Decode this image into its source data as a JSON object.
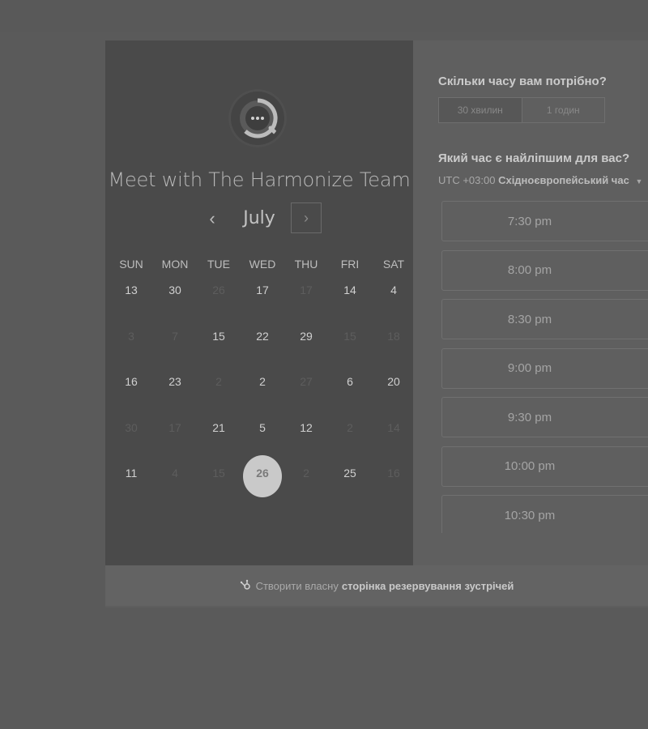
{
  "header": {
    "title": "Meet with The Harmonize Team",
    "avatar_icon": "chat-dots-icon"
  },
  "calendar": {
    "month": "July",
    "prev_icon": "chevron-left-icon",
    "next_icon": "chevron-right-icon",
    "prev_glyph": "‹",
    "next_glyph": "›",
    "weekdays": [
      "SUN",
      "MON",
      "TUE",
      "WED",
      "THU",
      "FRI",
      "SAT"
    ],
    "weeks": [
      [
        {
          "d": "13",
          "off": false
        },
        {
          "d": "30",
          "off": false
        },
        {
          "d": "26",
          "off": true
        },
        {
          "d": "17",
          "off": false
        },
        {
          "d": "17",
          "off": true
        },
        {
          "d": "14",
          "off": false
        },
        {
          "d": "4",
          "off": false
        }
      ],
      [
        {
          "d": "3",
          "off": true
        },
        {
          "d": "7",
          "off": true
        },
        {
          "d": "15",
          "off": false
        },
        {
          "d": "22",
          "off": false
        },
        {
          "d": "29",
          "off": false
        },
        {
          "d": "15",
          "off": true
        },
        {
          "d": "18",
          "off": true
        }
      ],
      [
        {
          "d": "16",
          "off": false
        },
        {
          "d": "23",
          "off": false
        },
        {
          "d": "2",
          "off": true
        },
        {
          "d": "2",
          "off": false
        },
        {
          "d": "27",
          "off": true
        },
        {
          "d": "6",
          "off": false
        },
        {
          "d": "20",
          "off": false
        }
      ],
      [
        {
          "d": "30",
          "off": true
        },
        {
          "d": "17",
          "off": true
        },
        {
          "d": "21",
          "off": false
        },
        {
          "d": "5",
          "off": false
        },
        {
          "d": "12",
          "off": false
        },
        {
          "d": "2",
          "off": true
        },
        {
          "d": "14",
          "off": true
        }
      ],
      [
        {
          "d": "11",
          "off": false
        },
        {
          "d": "4",
          "off": true
        },
        {
          "d": "15",
          "off": true
        },
        {
          "d": "26",
          "off": false,
          "selected": true
        },
        {
          "d": "2",
          "off": true
        },
        {
          "d": "25",
          "off": false
        },
        {
          "d": "16",
          "off": true
        }
      ]
    ]
  },
  "booking": {
    "duration_question": "Скільки часу вам потрібно?",
    "durations": [
      "30 хвилин",
      "1 годин"
    ],
    "active_duration_index": 0,
    "time_question": "Який час є найліпшим для вас?",
    "timezone_offset": "UTC +03:00",
    "timezone_name": "Східноєвропейський час",
    "timezone_caret_icon": "caret-down-icon",
    "slots": [
      "7:30 pm",
      "8:00 pm",
      "8:30 pm",
      "9:00 pm",
      "9:30 pm",
      "10:00 pm",
      "10:30 pm"
    ]
  },
  "footer": {
    "icon": "hubspot-sprocket-icon",
    "text": "Створити власну",
    "link": "сторінка резервування зустрічей"
  },
  "colors": {
    "left_panel": "#4a4a4a",
    "right_panel": "#5f5f5f",
    "selected_day": "#c9c9c9"
  }
}
